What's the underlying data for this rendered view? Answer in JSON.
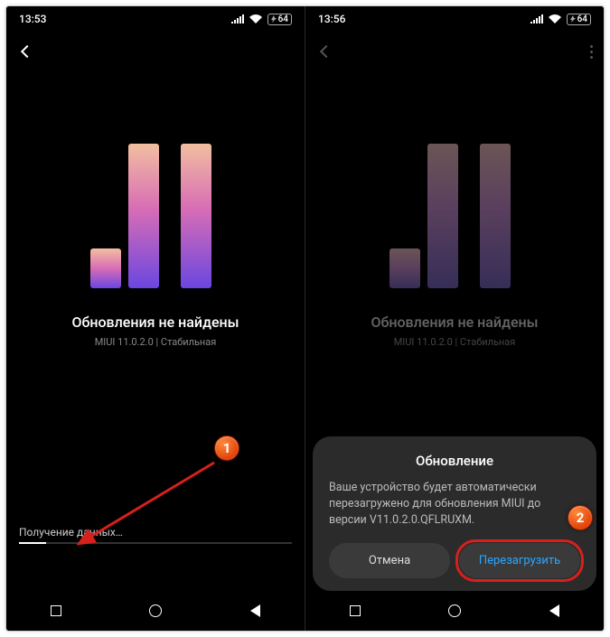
{
  "left": {
    "status_time": "13:53",
    "battery": "64",
    "title": "Обновления не найдены",
    "subtitle": "MIUI 11.0.2.0 | Стабильная",
    "loading_text": "Получение данных…"
  },
  "right": {
    "status_time": "13:56",
    "battery": "64",
    "title": "Обновления не найдены",
    "subtitle": "MIUI 11.0.2.0 | Стабильная",
    "dialog": {
      "title": "Обновление",
      "message": "Ваше устройство будет автоматически перезагружено для обновления MIUI до версии V11.0.2.0.QFLRUXM.",
      "cancel": "Отмена",
      "confirm": "Перезагрузить"
    }
  },
  "callouts": {
    "a": "1",
    "b": "2"
  }
}
